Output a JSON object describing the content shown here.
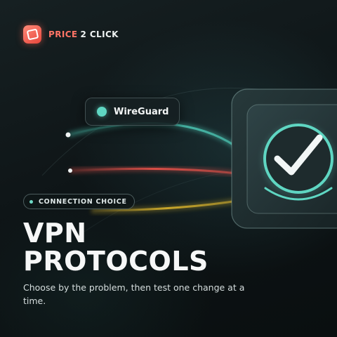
{
  "brand": {
    "accent": "PRICE",
    "rest": "2 CLICK",
    "icon": "price-tag-icon",
    "color": "#ff7466"
  },
  "protocol_chip": {
    "label": "WireGuard",
    "dot_color": "#5fd6c2"
  },
  "category_badge": {
    "label": "CONNECTION CHOICE"
  },
  "title": {
    "line1": "VPN",
    "line2": "PROTOCOLS"
  },
  "subtitle": "Choose by the problem, then test one change at a time.",
  "graphic": {
    "icon": "checkmark-shield-icon",
    "path_colors": [
      "#4fd0bd",
      "#e05048",
      "#d8b22c"
    ]
  }
}
